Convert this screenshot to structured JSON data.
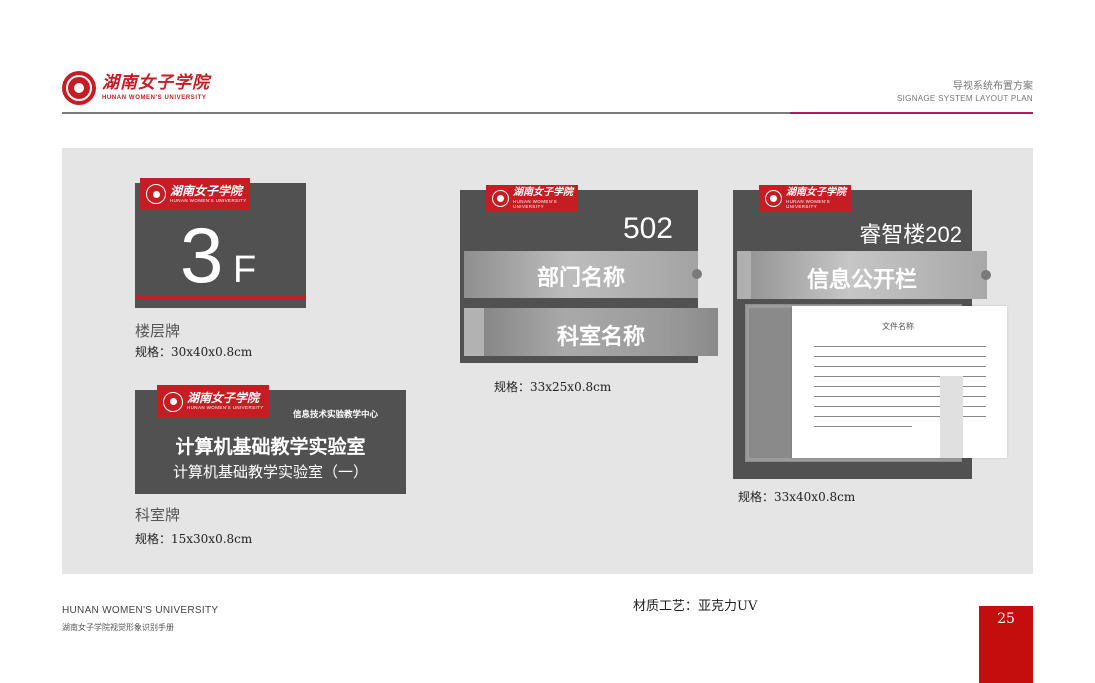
{
  "header": {
    "logo_cn": "湖南女子学院",
    "logo_en": "HUNAN WOMEN'S UNIVERSITY",
    "section_cn": "导视系统布置方案",
    "section_en": "SIGNAGE SYSTEM LAYOUT PLAN"
  },
  "floor_sign": {
    "badge_cn": "湖南女子学院",
    "badge_en": "HUNAN WOMEN'S UNIVERSITY",
    "floor_number": "3",
    "floor_suffix": "F",
    "caption": "楼层牌",
    "spec": "规格：30x40x0.8cm"
  },
  "dept_sign": {
    "badge_cn": "湖南女子学院",
    "badge_en": "HUNAN WOMEN'S UNIVERSITY",
    "center_name": "信息技术实验教学中心",
    "title": "计算机基础教学实验室",
    "subtitle": "计算机基础教学实验室（一）",
    "caption": "科室牌",
    "spec": "规格：15x30x0.8cm"
  },
  "room_sign": {
    "badge_cn": "湖南女子学院",
    "badge_en": "HUNAN WOMEN'S UNIVERSITY",
    "room_number": "502",
    "slot1": "部门名称",
    "slot2": "科室名称",
    "spec": "规格：33x25x0.8cm"
  },
  "info_sign": {
    "badge_cn": "湖南女子学院",
    "badge_en": "HUNAN WOMEN'S UNIVERSITY",
    "room_number": "睿智楼202",
    "slot": "信息公开栏",
    "paper_title": "文件名称",
    "spec": "规格：33x40x0.8cm"
  },
  "footer": {
    "university_en": "HUNAN WOMEN'S  UNIVERSITY",
    "manual_cn": "湖南女子学院视觉形象识别手册",
    "material": "材质工艺：亚克力UV",
    "page_number": "25"
  },
  "colors": {
    "brand_red": "#c51d23",
    "sign_grey": "#515152",
    "accent_magenta": "#b3195f",
    "panel_bg": "#e5e5e5"
  }
}
